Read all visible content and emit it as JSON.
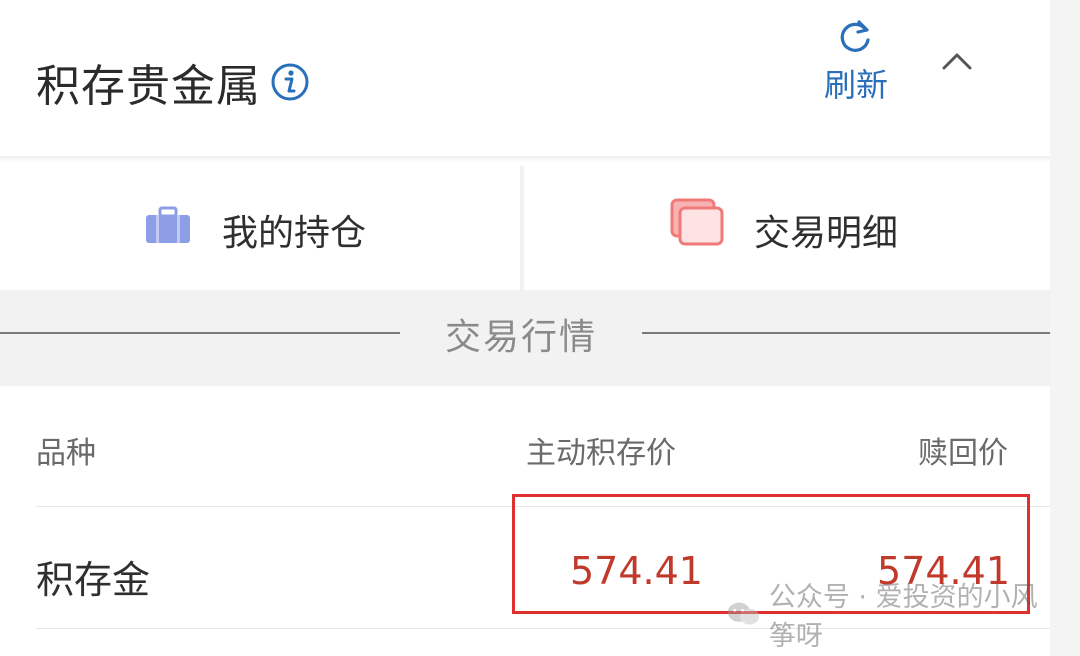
{
  "header": {
    "title": "积存贵金属",
    "refresh_label": "刷新"
  },
  "actions": {
    "holdings_label": "我的持仓",
    "details_label": "交易明细"
  },
  "section": {
    "title": "交易行情"
  },
  "table": {
    "columns": [
      "品种",
      "主动积存价",
      "赎回价"
    ],
    "rows": [
      {
        "variety": "积存金",
        "buy_price": "574.41",
        "redeem_price": "574.41"
      }
    ]
  },
  "watermark": {
    "text": "公众号 · 爱投资的小风筝呀"
  },
  "colors": {
    "accent_blue": "#2a6fba",
    "price_red": "#c0392b",
    "highlight_red": "#e0302e",
    "holdings_icon": "#8e9ee6",
    "details_icon": "#f07a7a"
  }
}
